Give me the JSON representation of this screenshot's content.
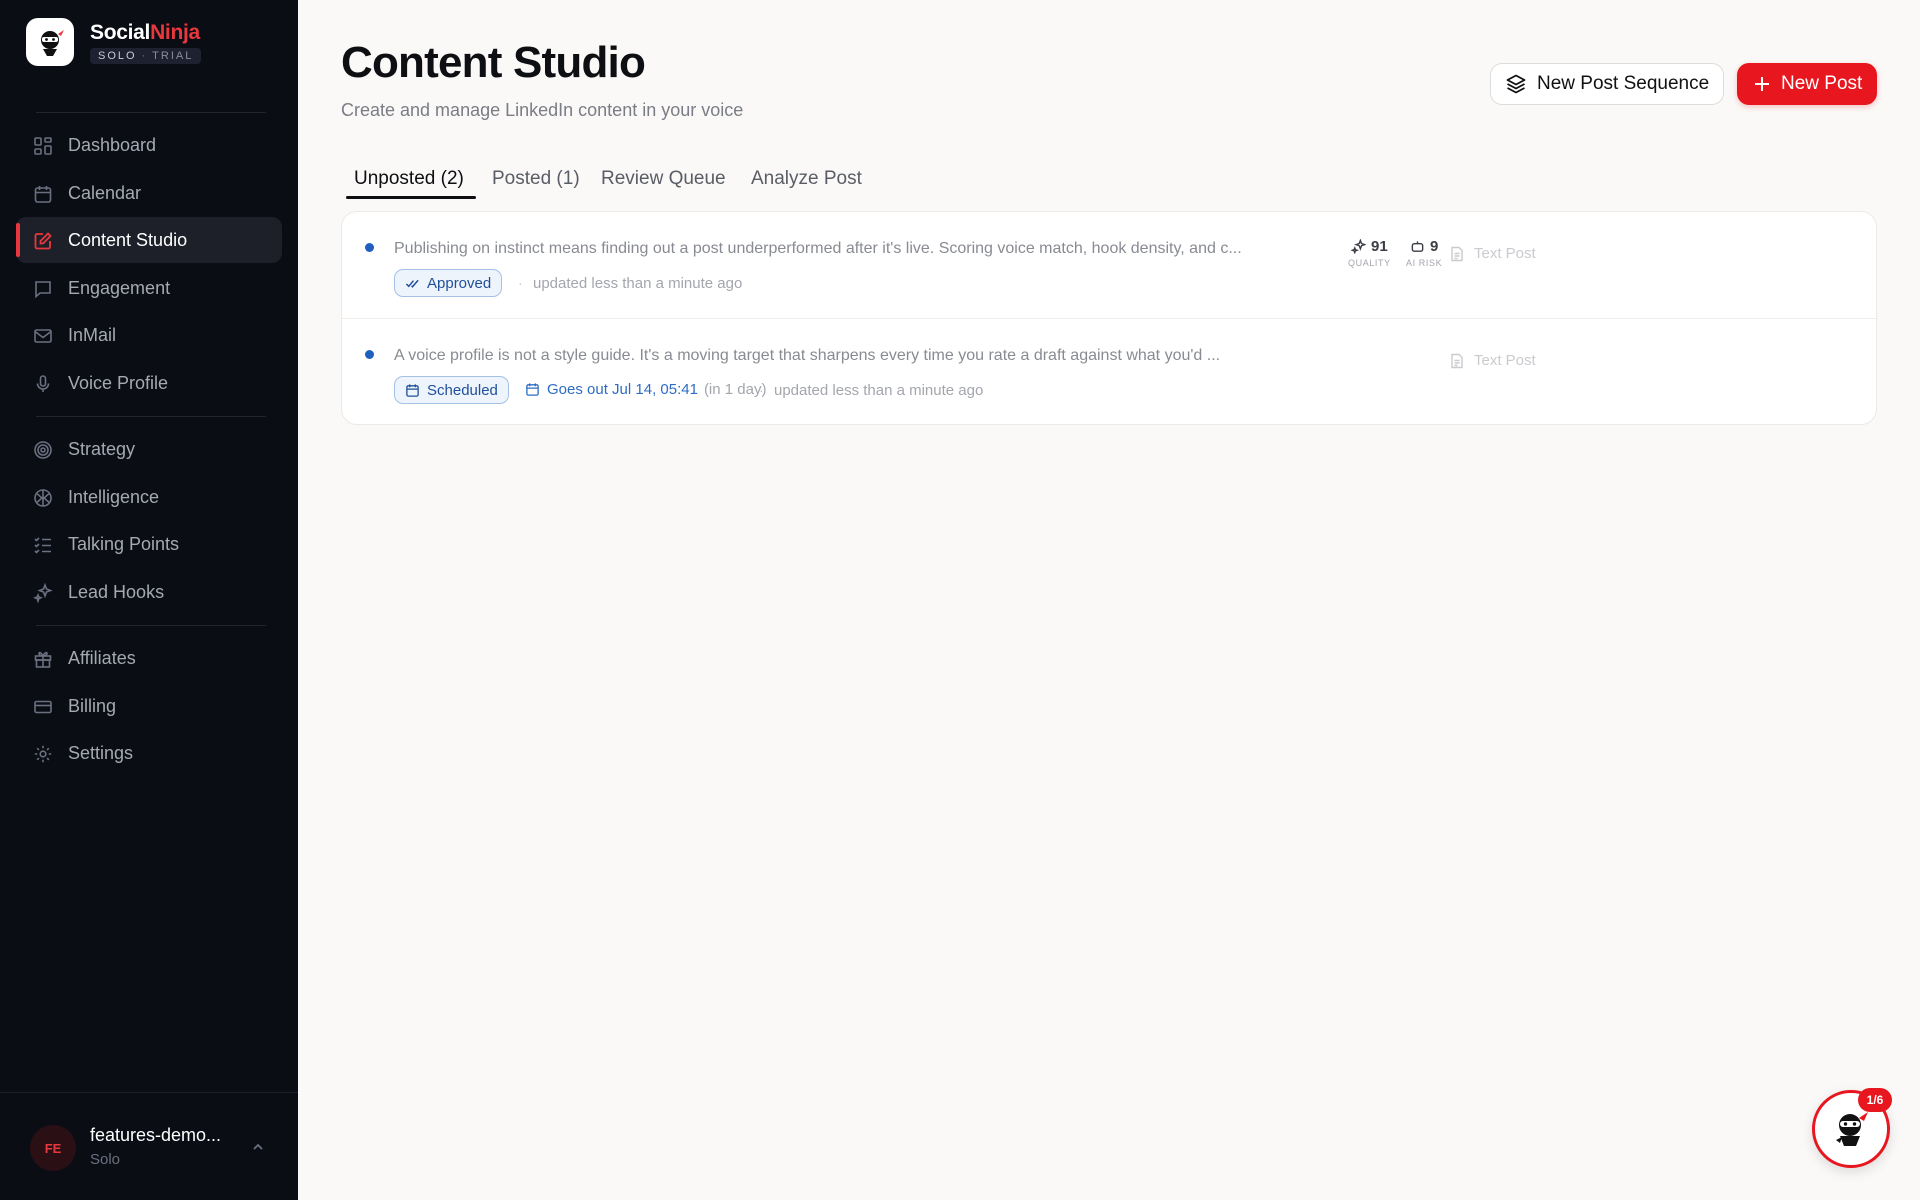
{
  "brand": {
    "name_part1": "Social",
    "name_part2": "Ninja",
    "plan": "SOLO",
    "separator": "·",
    "trial": "TRIAL",
    "accent_color": "#e8383d"
  },
  "sidebar": {
    "items": [
      {
        "label": "Dashboard",
        "icon": "grid-icon"
      },
      {
        "label": "Calendar",
        "icon": "calendar-icon"
      },
      {
        "label": "Content Studio",
        "icon": "edit-square-icon",
        "active": true
      },
      {
        "label": "Engagement",
        "icon": "chat-bubble-icon"
      },
      {
        "label": "InMail",
        "icon": "mail-icon"
      },
      {
        "label": "Voice Profile",
        "icon": "microphone-icon"
      },
      {
        "label": "Strategy",
        "icon": "target-icon"
      },
      {
        "label": "Intelligence",
        "icon": "brain-icon"
      },
      {
        "label": "Talking Points",
        "icon": "checklist-icon"
      },
      {
        "label": "Lead Hooks",
        "icon": "sparkles-icon"
      },
      {
        "label": "Affiliates",
        "icon": "gift-icon"
      },
      {
        "label": "Billing",
        "icon": "credit-card-icon"
      },
      {
        "label": "Settings",
        "icon": "gear-icon"
      }
    ],
    "user": {
      "initials": "FE",
      "name": "features-demo...",
      "plan": "Solo"
    }
  },
  "header": {
    "title": "Content Studio",
    "subtitle": "Create and manage LinkedIn content in your voice",
    "sequence_button": "New Post Sequence",
    "new_post_button": "New Post"
  },
  "tabs": [
    {
      "label": "Unposted (2)",
      "active": true
    },
    {
      "label": "Posted (1)"
    },
    {
      "label": "Review Queue"
    },
    {
      "label": "Analyze Post"
    }
  ],
  "posts": [
    {
      "text": "Publishing on instinct means finding out a post underperformed after it's live. Scoring voice match, hook density, and c...",
      "status": "Approved",
      "separator": "·",
      "updated": "updated less than a minute ago",
      "quality": "91",
      "quality_label": "QUALITY",
      "ai_risk": "9",
      "ai_risk_label": "AI RISK",
      "type": "Text Post"
    },
    {
      "text": "A voice profile is not a style guide. It's a moving target that sharpens every time you rate a draft against what you'd ...",
      "status": "Scheduled",
      "goes_out": "Goes out Jul 14, 05:41",
      "relative": "(in 1 day)",
      "separator": "·",
      "updated": "updated less than a minute ago",
      "type": "Text Post"
    }
  ],
  "assistant": {
    "badge": "1/6"
  }
}
